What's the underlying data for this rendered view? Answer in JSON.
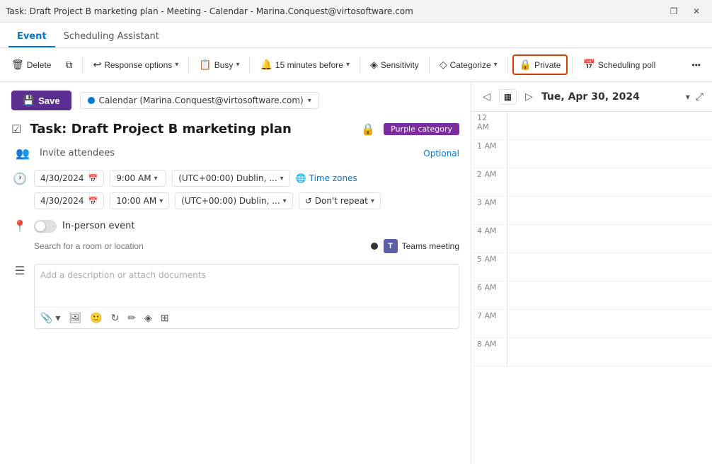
{
  "titleBar": {
    "text": "Task: Draft Project B marketing plan - Meeting - Calendar - Marina.Conquest@virtosoftware.com",
    "controls": {
      "restore": "❐",
      "close": "✕"
    }
  },
  "tabs": {
    "event": "Event",
    "schedulingAssistant": "Scheduling Assistant",
    "activeTab": "event"
  },
  "toolbar": {
    "delete": "Delete",
    "duplicate": "",
    "responseOptions": "Response options",
    "busy": "Busy",
    "reminder": "15 minutes before",
    "sensitivity": "Sensitivity",
    "categorize": "Categorize",
    "private": "Private",
    "schedulingPoll": "Scheduling poll",
    "more": "..."
  },
  "form": {
    "saveButton": "Save",
    "calendarSelect": "Calendar (Marina.Conquest@virtosoftware.com)",
    "eventTitle": "Task: Draft Project B marketing plan",
    "purpleCategory": "Purple category",
    "inviteAttendees": "Invite attendees",
    "optional": "Optional",
    "startDate": "4/30/2024",
    "startTime": "9:00 AM",
    "endDate": "4/30/2024",
    "endTime": "10:00 AM",
    "timezone": "(UTC+00:00) Dublin, ...",
    "timeZonesLink": "Time zones",
    "dontRepeat": "Don't repeat",
    "inPersonEvent": "In-person event",
    "searchRoom": "Search for a room or location",
    "teamsMeeting": "Teams meeting",
    "descriptionPlaceholder": "Add a description or attach documents"
  },
  "calendarPanel": {
    "dateTitle": "Tue, Apr 30, 2024",
    "timeSlots": [
      "12 AM",
      "1 AM",
      "2 AM",
      "3 AM",
      "4 AM",
      "5 AM",
      "6 AM",
      "7 AM",
      "8 AM"
    ]
  },
  "icons": {
    "save": "💾",
    "delete": "🗑",
    "responseOptions": "↩",
    "busy": "📋",
    "reminder": "🔔",
    "sensitivity": "◎",
    "categorize": "◇",
    "lock": "🔒",
    "schedulingPoll": "📅",
    "calendarNav": "◁",
    "calendarNavNext": "▷",
    "calendarToday": "▦",
    "calendarExpand": "⤢",
    "calIcon": "📅",
    "clockIcon": "🕐",
    "locationIcon": "📍",
    "attendeeIcon": "👥",
    "taskIcon": "☑",
    "descIcon": "☰",
    "timezoneIcon": "🌐",
    "teamsMeeting": "T"
  }
}
